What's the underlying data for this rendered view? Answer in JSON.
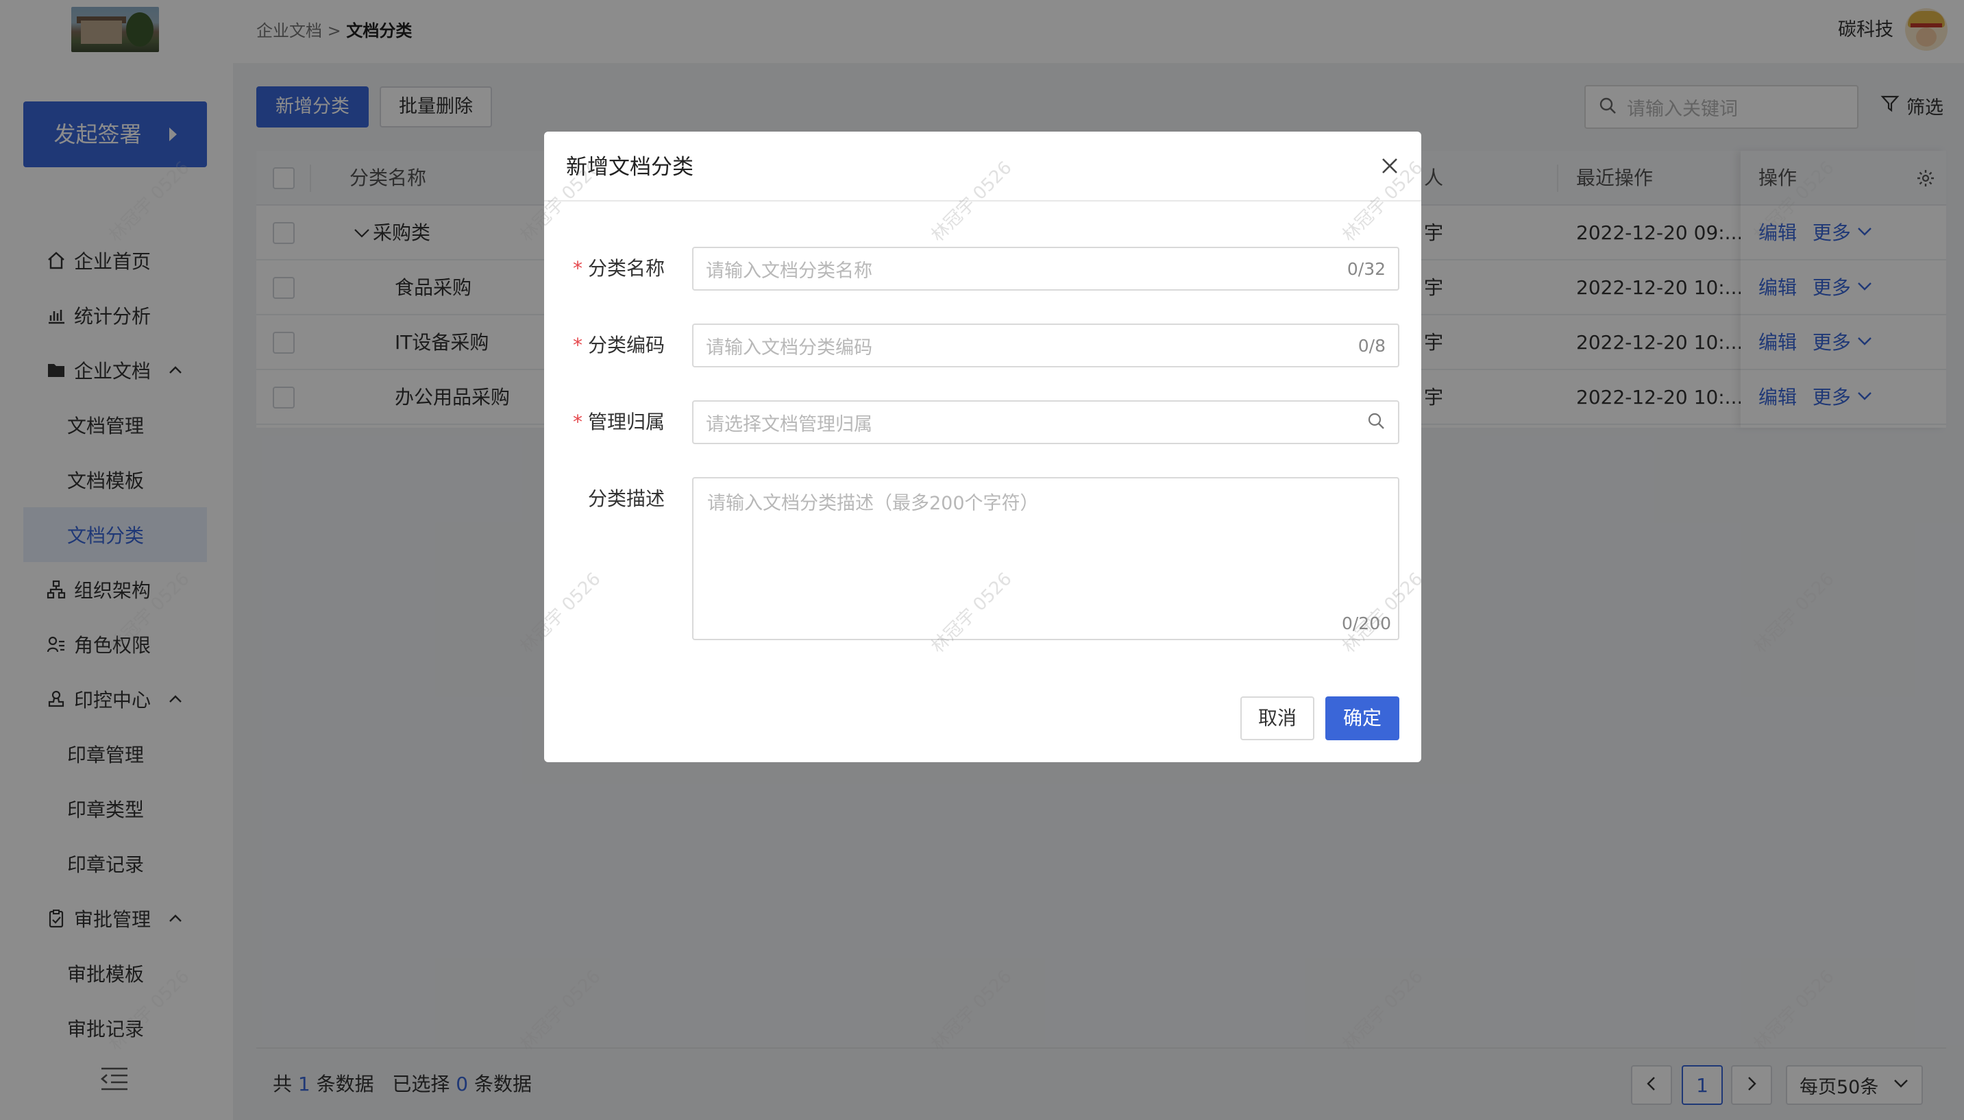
{
  "header": {
    "breadcrumb_parent": "企业文档",
    "breadcrumb_sep": ">",
    "breadcrumb_current": "文档分类",
    "user_name": "碳科技"
  },
  "sidebar": {
    "launch_label": "发起签署",
    "items": [
      {
        "label": "企业首页",
        "icon": "home-icon"
      },
      {
        "label": "统计分析",
        "icon": "bar-chart-icon"
      },
      {
        "label": "企业文档",
        "icon": "folder-icon",
        "expanded": true
      },
      {
        "label": "文档管理"
      },
      {
        "label": "文档模板"
      },
      {
        "label": "文档分类",
        "active": true
      },
      {
        "label": "组织架构",
        "icon": "org-chart-icon"
      },
      {
        "label": "角色权限",
        "icon": "role-icon"
      },
      {
        "label": "印控中心",
        "icon": "stamp-icon",
        "expanded": true
      },
      {
        "label": "印章管理"
      },
      {
        "label": "印章类型"
      },
      {
        "label": "印章记录"
      },
      {
        "label": "审批管理",
        "icon": "clipboard-check-icon",
        "expanded": true
      },
      {
        "label": "审批模板"
      },
      {
        "label": "审批记录"
      }
    ]
  },
  "toolbar": {
    "add_label": "新增分类",
    "batch_delete_label": "批量删除",
    "search_placeholder": "请输入关键词",
    "filter_label": "筛选"
  },
  "table": {
    "columns": {
      "name": "分类名称",
      "owner": "人",
      "last_op": "最近操作",
      "actions": "操作"
    },
    "rows": [
      {
        "name": "采购类",
        "owner": "宇",
        "last_op": "2022-12-20 09:...",
        "edit": "编辑",
        "more": "更多",
        "level": 0
      },
      {
        "name": "食品采购",
        "owner": "宇",
        "last_op": "2022-12-20 10:...",
        "edit": "编辑",
        "more": "更多",
        "level": 1
      },
      {
        "name": "IT设备采购",
        "owner": "宇",
        "last_op": "2022-12-20 10:...",
        "edit": "编辑",
        "more": "更多",
        "level": 1
      },
      {
        "name": "办公用品采购",
        "owner": "宇",
        "last_op": "2022-12-20 10:...",
        "edit": "编辑",
        "more": "更多",
        "level": 1
      }
    ]
  },
  "footer": {
    "total_prefix": "共",
    "total_count": "1",
    "total_suffix": "条数据",
    "selected_prefix": "已选择",
    "selected_count": "0",
    "selected_suffix": "条数据",
    "current_page": "1",
    "page_size": "每页50条"
  },
  "modal": {
    "title": "新增文档分类",
    "fields": {
      "name": {
        "label": "分类名称",
        "placeholder": "请输入文档分类名称",
        "counter": "0/32",
        "required": true
      },
      "code": {
        "label": "分类编码",
        "placeholder": "请输入文档分类编码",
        "counter": "0/8",
        "required": true
      },
      "owner": {
        "label": "管理归属",
        "placeholder": "请选择文档管理归属",
        "required": true
      },
      "desc": {
        "label": "分类描述",
        "placeholder": "请输入文档分类描述（最多200个字符）",
        "counter": "0/200"
      }
    },
    "required_mark": "*",
    "cancel_label": "取消",
    "ok_label": "确定"
  },
  "watermark": "林冠宇 0526",
  "colors": {
    "accent": "#3a66d8",
    "required": "#e5484d"
  }
}
